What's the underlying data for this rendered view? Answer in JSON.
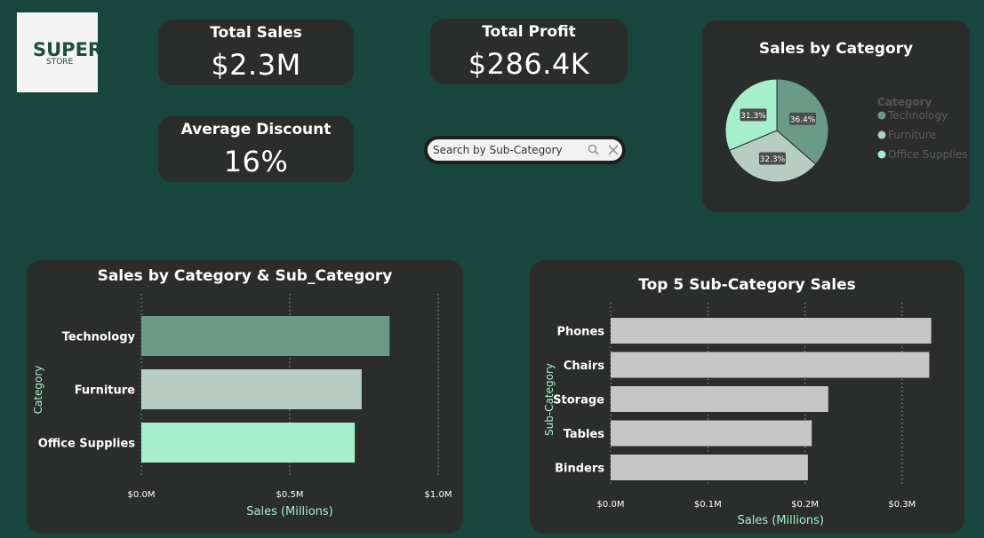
{
  "logo": {
    "line1": "SUPER",
    "line2": "STORE"
  },
  "kpis": {
    "total_sales": {
      "label": "Total Sales",
      "value": "$2.3M"
    },
    "total_profit": {
      "label": "Total Profit",
      "value": "$286.4K"
    },
    "avg_discount": {
      "label": "Average Discount",
      "value": "16%"
    }
  },
  "search": {
    "placeholder": "Search by Sub-Category"
  },
  "colors": {
    "background": "#18463c",
    "card": "#2b2d2c",
    "technology": "#6a9a88",
    "furniture": "#b7cdc4",
    "office_supplies": "#a6efcc",
    "top5_bar": "#c6c6c6"
  },
  "chart_data": [
    {
      "type": "pie",
      "title": "Sales by Category",
      "legend_title": "Category",
      "legend_position": "right",
      "labels": [
        "Technology",
        "Furniture",
        "Office Supplies"
      ],
      "values": [
        36.4,
        32.3,
        31.3
      ],
      "data_labels": [
        "36.4%",
        "32.3%",
        "31.3%"
      ],
      "colors": [
        "#6a9a88",
        "#b7cdc4",
        "#a6efcc"
      ]
    },
    {
      "type": "bar",
      "orientation": "horizontal",
      "title": "Sales by Category & Sub_Category",
      "categories": [
        "Technology",
        "Furniture",
        "Office Supplies"
      ],
      "values": [
        0.836,
        0.742,
        0.719
      ],
      "colors": [
        "#6a9a88",
        "#b7cdc4",
        "#a6efcc"
      ],
      "xlabel": "Sales (Millions)",
      "ylabel": "Category",
      "xlim": [
        0,
        1.0
      ],
      "xticks": [
        0,
        0.5,
        1.0
      ],
      "xtick_labels": [
        "$0.0M",
        "$0.5M",
        "$1.0M"
      ],
      "grid": true
    },
    {
      "type": "bar",
      "orientation": "horizontal",
      "title": "Top 5 Sub-Category Sales",
      "categories": [
        "Phones",
        "Chairs",
        "Storage",
        "Tables",
        "Binders"
      ],
      "values": [
        0.33,
        0.328,
        0.224,
        0.207,
        0.203
      ],
      "colors": [
        "#c6c6c6"
      ],
      "xlabel": "Sales (Millions)",
      "ylabel": "Sub-Category",
      "xlim": [
        0,
        0.35
      ],
      "xticks": [
        0,
        0.1,
        0.2,
        0.3
      ],
      "xtick_labels": [
        "$0.0M",
        "$0.1M",
        "$0.2M",
        "$0.3M"
      ],
      "grid": true
    }
  ]
}
